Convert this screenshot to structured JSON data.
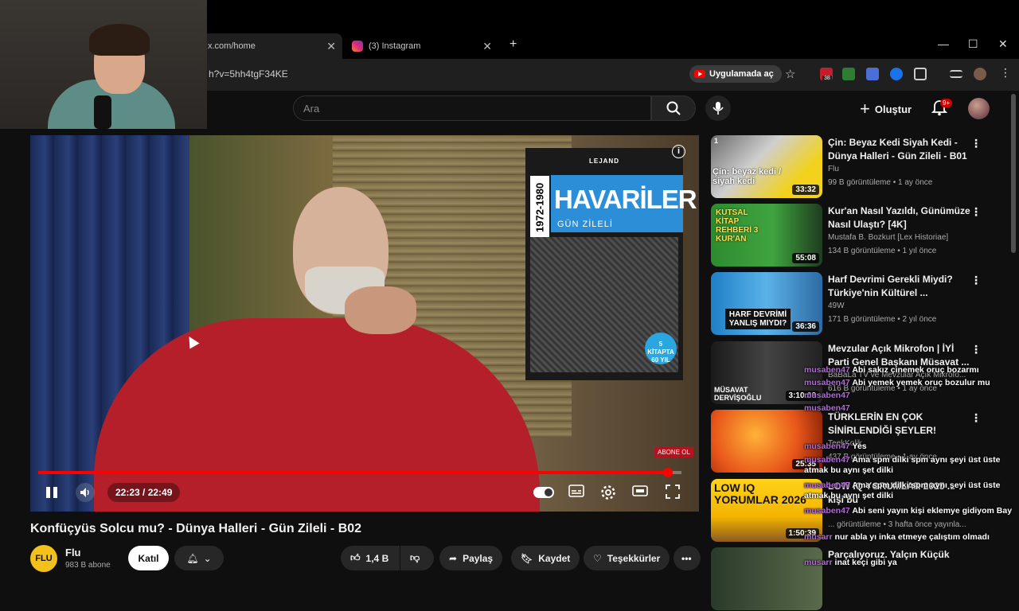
{
  "browser": {
    "tabs": [
      {
        "label": "x.com/home"
      },
      {
        "label": "(3) Instagram"
      }
    ],
    "url": "h?v=5hh4tgF34KE",
    "open_in_app": "Uygulamada aç",
    "ext_badge": "38"
  },
  "youtube": {
    "search_placeholder": "Ara",
    "create_label": "Oluştur",
    "notif_count": "9+"
  },
  "player": {
    "time": "22:23 / 22:49",
    "progress_percent": 97.9,
    "book": {
      "publisher": "LEJAND",
      "years": "1972-1980",
      "title": "HAVARİLER",
      "subtitle": "GÜN ZİLELİ",
      "seal": "5 KİTAPTA 60 YIL"
    },
    "subscribe_overlay": "ABONE OL"
  },
  "video": {
    "title": "Konfüçyüs Solcu mu? - Dünya Halleri - Gün Zileli - B02",
    "channel": "Flu",
    "channel_logo": "FLU",
    "subscribers": "983 B abone",
    "join": "Katıl",
    "likes": "1,4 B",
    "share": "Paylaş",
    "save": "Kaydet",
    "thanks": "Teşekkürler"
  },
  "recommendations": [
    {
      "title": "Çin: Beyaz Kedi Siyah Kedi - Dünya Halleri - Gün Zileli - B01",
      "channel": "Flu",
      "meta": "99 B görüntüleme • 1 ay önce",
      "duration": "33:32",
      "thumb_text": "Çin: beyaz kedi / siyah kedi",
      "index_label": "1"
    },
    {
      "title": "Kur'an Nasıl Yazıldı, Günümüze Nasıl Ulaştı? [4K]",
      "channel": "Mustafa B. Bozkurt [Lex Historiae]",
      "meta": "134 B görüntüleme • 1 yıl önce",
      "duration": "55:08",
      "thumb_text": "KUTSAL KİTAP REHBERİ 3 KUR'AN"
    },
    {
      "title": "Harf Devrimi Gerekli Miydi? Türkiye'nin Kültürel ...",
      "channel": "49W",
      "meta": "171 B görüntüleme • 2 yıl önce",
      "duration": "36:36",
      "thumb_text": "HARF DEVRİMİ YANLIŞ MIYDI?"
    },
    {
      "title": "Mevzular Açık Mikrofon | İYİ Parti Genel Başkanı Müsavat ...",
      "channel": "BaBaLa TV ve Mevzular Açık Mikrofo...",
      "meta": "616 B görüntüleme • 1 ay önce",
      "duration": "3:10:03",
      "thumb_text": "MÜSAVAT DERVİŞOĞLU"
    },
    {
      "title": "TÜRKLERİN EN ÇOK SİNİRLENDİĞİ ŞEYLER!",
      "channel": "TeekKolik",
      "meta": "437 B görüntüleme • 1 ay önce",
      "duration": "25:35",
      "thumb_text": ""
    },
    {
      "title": "LOW IQ YORUMLAR 2025 ... kişi bu",
      "channel": "",
      "meta": "... görüntüleme • 3 hafta önce yayınla...",
      "duration": "1:50:39",
      "thumb_text": "LOW IQ YORUMLAR 2026"
    },
    {
      "title": "Parçalıyoruz. Yalçın Küçük",
      "channel": "",
      "meta": "",
      "duration": "",
      "thumb_text": ""
    }
  ],
  "chat": [
    {
      "user": "musaben47",
      "text": "Abi sakız çinemek oruç bozarmı"
    },
    {
      "user": "musaben47",
      "text": "Abi yemek yemek oruç bozulur mu"
    },
    {
      "user": "musaben47",
      "text": ""
    },
    {
      "user": "musaben47",
      "text": ""
    },
    {
      "user": "musaben47",
      "text": "Yes"
    },
    {
      "user": "musaben47",
      "text": "Ama spm dilki spm aynı şeyi üst üste atmak bu aynı şet dilki"
    },
    {
      "user": "musaben47",
      "text": "Ama spm dilki spm aynı şeyi üst üste atmak bu aynı şet dilki"
    },
    {
      "user": "musaben47",
      "text": "Abi seni yayın kişi eklemye gidiyom Bay"
    },
    {
      "user": "musarr",
      "text": "nur abla yı inka etmeye çalıştım olmadı"
    },
    {
      "user": "musarr",
      "text": "inat keçi gibi ya"
    }
  ],
  "colors": {
    "accent": "#ff0000",
    "chat_name": "#b06bd6"
  }
}
